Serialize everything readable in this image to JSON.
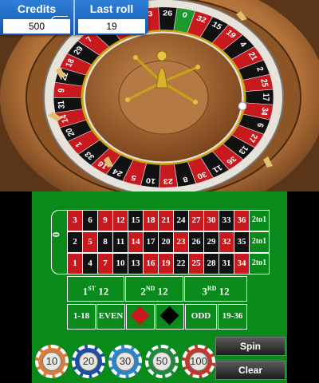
{
  "stats": {
    "credits_label": "Credits",
    "credits_value": "500",
    "last_roll_label": "Last roll",
    "last_roll_value": "19"
  },
  "wheel": {
    "sequence": [
      "0",
      "32",
      "15",
      "19",
      "4",
      "21",
      "2",
      "25",
      "17",
      "34",
      "6",
      "27",
      "13",
      "36",
      "11",
      "30",
      "8",
      "23",
      "10",
      "5",
      "24",
      "16",
      "33",
      "1",
      "20",
      "14",
      "31",
      "9",
      "22",
      "18",
      "29",
      "7",
      "28",
      "12",
      "35",
      "3",
      "26"
    ],
    "red_numbers": [
      1,
      3,
      5,
      7,
      9,
      12,
      14,
      16,
      18,
      19,
      21,
      23,
      25,
      27,
      30,
      32,
      34,
      36
    ]
  },
  "table": {
    "zero": "0",
    "rows": [
      [
        "3",
        "6",
        "9",
        "12",
        "15",
        "18",
        "21",
        "24",
        "27",
        "30",
        "33",
        "36"
      ],
      [
        "2",
        "5",
        "8",
        "11",
        "14",
        "17",
        "20",
        "23",
        "26",
        "29",
        "32",
        "35"
      ],
      [
        "1",
        "4",
        "7",
        "10",
        "13",
        "16",
        "19",
        "22",
        "25",
        "28",
        "31",
        "34"
      ]
    ],
    "column_bets": [
      "2to1",
      "2to1",
      "2to1"
    ],
    "dozens": [
      {
        "num": "1",
        "sup": "ST",
        "suffix": "12"
      },
      {
        "num": "2",
        "sup": "ND",
        "suffix": "12"
      },
      {
        "num": "3",
        "sup": "RD",
        "suffix": "12"
      }
    ],
    "outside": {
      "low": "1-18",
      "even": "EVEN",
      "odd": "ODD",
      "high": "19-36"
    },
    "colors": {
      "felt": "#0b8a1c",
      "red": "#c8191e",
      "black": "#111111"
    }
  },
  "buttons": {
    "spin": "Spin",
    "clear": "Clear"
  },
  "chips": [
    {
      "label": "10",
      "color": "#d97c3a"
    },
    {
      "label": "20",
      "color": "#1d4fa3"
    },
    {
      "label": "30",
      "color": "#2a86c9"
    },
    {
      "label": "50",
      "color": "#1f8a3a"
    },
    {
      "label": "100",
      "color": "#c0392b"
    }
  ]
}
